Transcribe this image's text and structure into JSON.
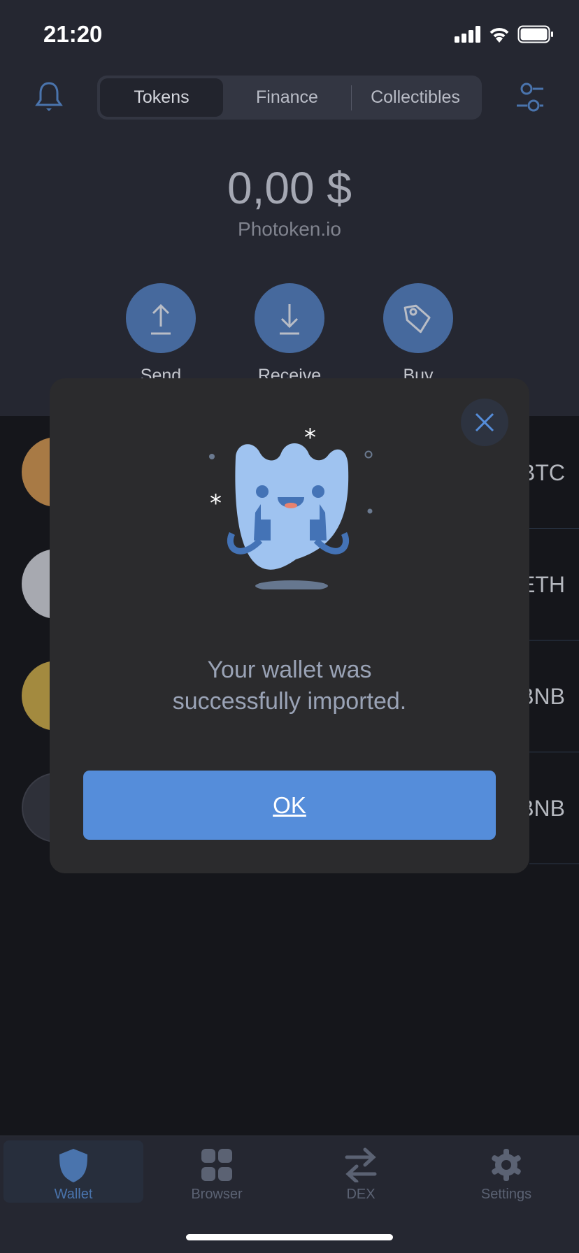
{
  "status": {
    "time": "21:20"
  },
  "segments": [
    {
      "label": "Tokens",
      "active": true
    },
    {
      "label": "Finance"
    },
    {
      "label": "Collectibles"
    }
  ],
  "balance": {
    "amount": "0,00 $",
    "wallet_name": "Photoken.io"
  },
  "actions": [
    {
      "label": "Send",
      "icon": "upload-icon"
    },
    {
      "label": "Receive",
      "icon": "download-icon"
    },
    {
      "label": "Buy",
      "icon": "tag-icon"
    }
  ],
  "tokens": [
    {
      "ticker": "BTC",
      "color": "#a87a45"
    },
    {
      "ticker": "ETH",
      "color": "#a7a9b0"
    },
    {
      "ticker": "BNB",
      "color": "#a38a3f"
    },
    {
      "ticker": "BNB",
      "color": "#2e3039"
    }
  ],
  "modal": {
    "message_line1": "Your wallet was",
    "message_line2": "successfully imported.",
    "ok_label": "OK"
  },
  "tabbar": [
    {
      "label": "Wallet",
      "icon": "shield-icon",
      "active": true
    },
    {
      "label": "Browser",
      "icon": "grid-icon"
    },
    {
      "label": "DEX",
      "icon": "swap-arrows-icon"
    },
    {
      "label": "Settings",
      "icon": "gear-icon"
    }
  ],
  "colors": {
    "accent": "#558dda",
    "action_button": "#46699d"
  }
}
